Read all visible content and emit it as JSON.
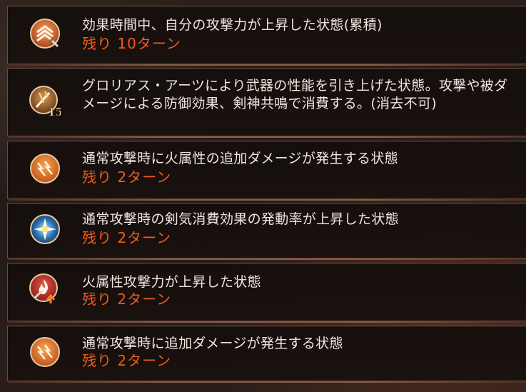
{
  "buffs": [
    {
      "icon": "attack-up-stacking-icon",
      "description": "効果時間中、自分の攻撃力が上昇した状態(累積)",
      "remaining": "残り 10ターン"
    },
    {
      "icon": "glorious-arts-weapon-icon",
      "icon_number": "15",
      "description": "グロリアス・アーツにより武器の性能を引き上げた状態。攻撃や被ダメージによる防御効果、剣神共鳴で消費する。(消去不可)",
      "remaining": ""
    },
    {
      "icon": "fire-bonus-damage-icon",
      "description": "通常攻撃時に火属性の追加ダメージが発生する状態",
      "remaining": "残り 2ターン"
    },
    {
      "icon": "sword-aura-star-icon",
      "description": "通常攻撃時の剣気消費効果の発動率が上昇した状態",
      "remaining": "残り 2ターン"
    },
    {
      "icon": "fire-attack-up-icon",
      "description": "火属性攻撃力が上昇した状態",
      "remaining": "残り 2ターン"
    },
    {
      "icon": "bonus-damage-icon",
      "description": "通常攻撃時に追加ダメージが発生する状態",
      "remaining": "残り 2ターン"
    }
  ],
  "colors": {
    "remaining_text": "#f05a1e",
    "description_text": "#efe6df",
    "row_border": "#6b4a3a"
  }
}
